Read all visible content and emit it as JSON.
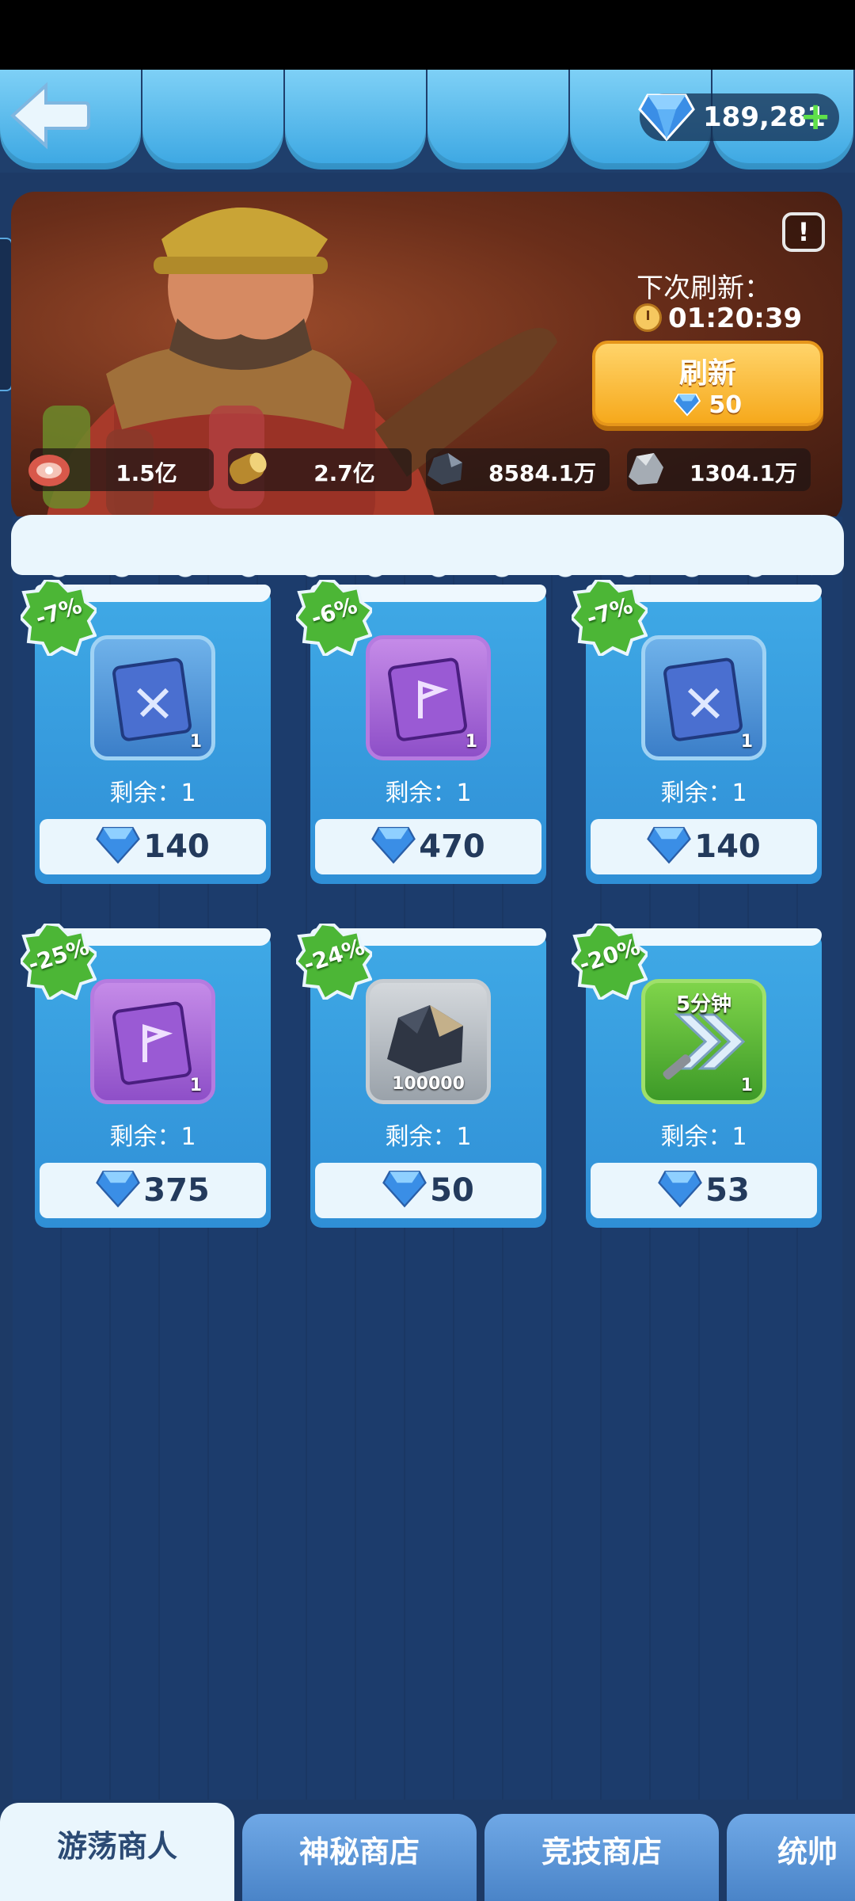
{
  "header": {
    "gem_balance": "189,281",
    "plus": "+"
  },
  "hero": {
    "info": "!",
    "next_refresh_label": "下次刷新：",
    "countdown": "01:20:39",
    "refresh_button": {
      "label": "刷新",
      "cost": "50"
    }
  },
  "resources": [
    {
      "icon": "meat-icon",
      "value": "1.5亿"
    },
    {
      "icon": "wood-log-icon",
      "value": "2.7亿"
    },
    {
      "icon": "coal-ore-icon",
      "value": "8584.1万"
    },
    {
      "icon": "stone-ore-icon",
      "value": "1304.1万"
    }
  ],
  "shop_items": [
    {
      "discount": "-7%",
      "icon": "blue-skill-book-icon",
      "quantity": "1",
      "remaining": "剩余：1",
      "price": "140"
    },
    {
      "discount": "-6%",
      "icon": "purple-flag-book-icon",
      "quantity": "1",
      "remaining": "剩余：1",
      "price": "470"
    },
    {
      "discount": "-7%",
      "icon": "blue-skill-book-icon",
      "quantity": "1",
      "remaining": "剩余：1",
      "price": "140"
    },
    {
      "discount": "-25%",
      "icon": "purple-flag-book-icon",
      "quantity": "1",
      "remaining": "剩余：1",
      "price": "375"
    },
    {
      "discount": "-24%",
      "icon": "coal-ore-icon",
      "quantity": "100000",
      "remaining": "剩余：1",
      "price": "50"
    },
    {
      "discount": "-20%",
      "icon": "speedup-icon",
      "time_label": "5分钟",
      "quantity": "1",
      "remaining": "剩余：1",
      "price": "53"
    }
  ],
  "tabs": [
    {
      "label": "游荡商人",
      "active": true
    },
    {
      "label": "神秘商店",
      "active": false
    },
    {
      "label": "竞技商店",
      "active": false
    },
    {
      "label": "统帅商",
      "active": false
    }
  ],
  "colors": {
    "accent_gold": "#f6a91c",
    "discount_green": "#4cb636",
    "card_blue": "#3fa9e6",
    "background": "#1d3a66"
  }
}
